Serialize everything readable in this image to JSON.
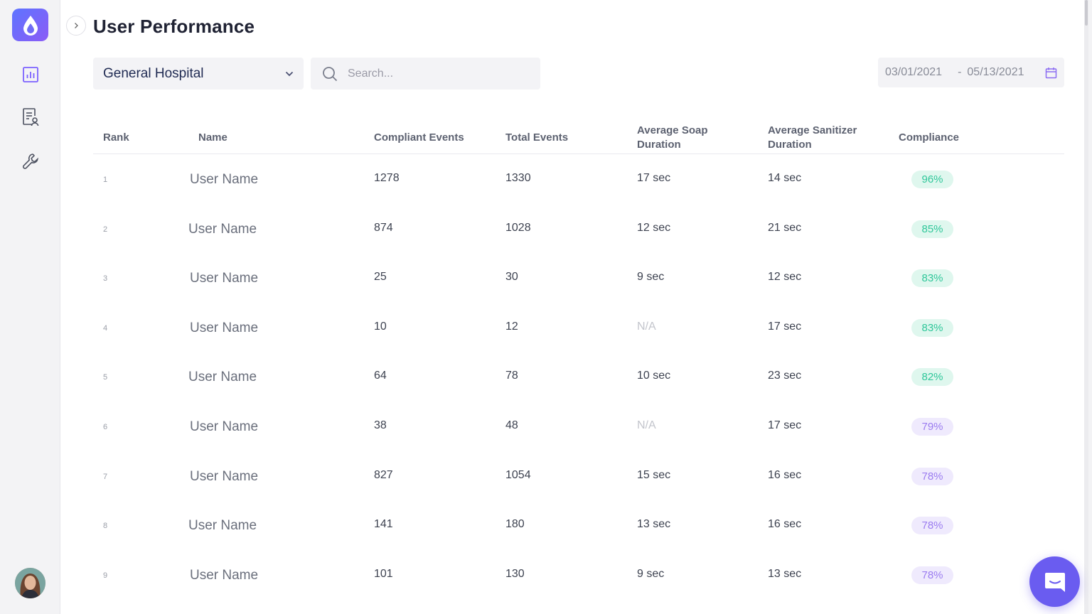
{
  "page": {
    "title": "User Performance"
  },
  "filters": {
    "hospital": "General Hospital",
    "search_placeholder": "Search...",
    "date_start": "03/01/2021",
    "date_separator": "-",
    "date_end": "05/13/2021"
  },
  "table": {
    "headers": {
      "rank": "Rank",
      "name": "Name",
      "compliant": "Compliant Events",
      "total": "Total Events",
      "soap_1": "Average Soap",
      "soap_2": "Duration",
      "sanitizer_1": "Average Sanitizer",
      "sanitizer_2": "Duration",
      "compliance": "Compliance"
    },
    "rows": [
      {
        "rank": "1",
        "name": "User Name",
        "compliant": "1278",
        "total": "1330",
        "soap": "17 sec",
        "sanitizer": "14 sec",
        "compliance": "96%"
      },
      {
        "rank": "2",
        "name": "User Name",
        "compliant": "874",
        "total": "1028",
        "soap": "12 sec",
        "sanitizer": "21 sec",
        "compliance": "85%"
      },
      {
        "rank": "3",
        "name": "User Name",
        "compliant": "25",
        "total": "30",
        "soap": "9 sec",
        "sanitizer": "12 sec",
        "compliance": "83%"
      },
      {
        "rank": "4",
        "name": "User Name",
        "compliant": "10",
        "total": "12",
        "soap": "N/A",
        "sanitizer": "17 sec",
        "compliance": "83%"
      },
      {
        "rank": "5",
        "name": "User Name",
        "compliant": "64",
        "total": "78",
        "soap": "10 sec",
        "sanitizer": "23 sec",
        "compliance": "82%"
      },
      {
        "rank": "6",
        "name": "User Name",
        "compliant": "38",
        "total": "48",
        "soap": "N/A",
        "sanitizer": "17 sec",
        "compliance": "79%"
      },
      {
        "rank": "7",
        "name": "User Name",
        "compliant": "827",
        "total": "1054",
        "soap": "15 sec",
        "sanitizer": "16 sec",
        "compliance": "78%"
      },
      {
        "rank": "8",
        "name": "User Name",
        "compliant": "141",
        "total": "180",
        "soap": "13 sec",
        "sanitizer": "16 sec",
        "compliance": "78%"
      },
      {
        "rank": "9",
        "name": "User Name",
        "compliant": "101",
        "total": "130",
        "soap": "9 sec",
        "sanitizer": "13 sec",
        "compliance": "78%"
      }
    ]
  },
  "colors": {
    "brand": "#6a5cf0",
    "compliance_high_bg": "#dff7ee",
    "compliance_high_text": "#2fc79a",
    "compliance_low_bg": "#efeafd",
    "compliance_low_text": "#9b7cf0"
  },
  "icons": {
    "logo": "water-drop-icon",
    "nav": [
      "bar-chart-icon",
      "report-user-icon",
      "wrench-icon"
    ],
    "collapse": "chevron-right-icon",
    "search": "search-icon",
    "dropdown": "chevron-down-icon",
    "calendar": "calendar-icon",
    "chat": "chat-icon"
  }
}
